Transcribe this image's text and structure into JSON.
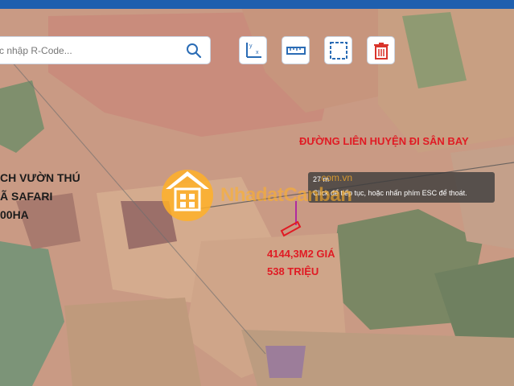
{
  "search": {
    "placeholder": "c nhập R-Code..."
  },
  "toolbar": {
    "measure_axis_label": "y",
    "measure_axis_label_x": "x"
  },
  "tooltip": {
    "distance": "27 m",
    "message": "Click để tiếp tục, hoặc nhấn phím ESC để thoát."
  },
  "labels": {
    "road": "ĐƯỜNG LIÊN HUYỆN ĐI SÂN BAY",
    "lot_area": "4144,3M2 GIÁ",
    "lot_price": "538 TRIỆU",
    "zoo_line1": "CH VƯỜN THÚ",
    "zoo_line2": "Ã SAFARI",
    "zoo_line3": "00HA"
  },
  "watermark": {
    "brand": "NhadatCanban",
    "suffix": ".com.vn"
  },
  "colors": {
    "topbar": "#1f5fae",
    "label_red": "#e01b24",
    "icon_blue": "#2a6cb5",
    "icon_red": "#d9342b"
  }
}
